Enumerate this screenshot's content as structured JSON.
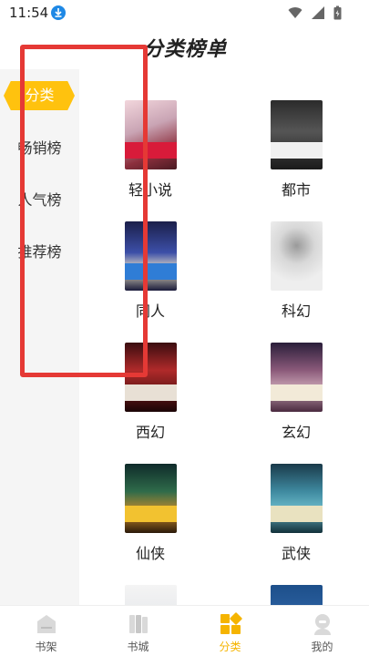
{
  "status": {
    "time": "11:54"
  },
  "title": "分类榜单",
  "sidebar": {
    "items": [
      "分类",
      "畅销榜",
      "人气榜",
      "推荐榜"
    ]
  },
  "categories": [
    "轻小说",
    "都市",
    "同人",
    "科幻",
    "西幻",
    "玄幻",
    "仙侠",
    "武侠"
  ],
  "tabs": [
    "书架",
    "书城",
    "分类",
    "我的"
  ],
  "colors": {
    "accent": "#ffc20e",
    "annotation": "#e53935",
    "tab_active": "#f5b400"
  }
}
